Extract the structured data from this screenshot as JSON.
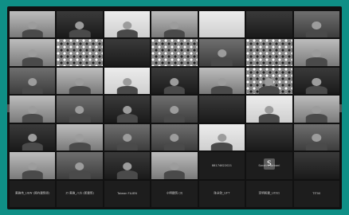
{
  "meeting": {
    "tiles": [
      {
        "label": "",
        "style": "bright",
        "person": true
      },
      {
        "label": "",
        "style": "dark",
        "person": true
      },
      {
        "label": "",
        "style": "light",
        "person": true
      },
      {
        "label": "",
        "style": "bright",
        "person": true
      },
      {
        "label": "",
        "style": "light",
        "person": false
      },
      {
        "label": "",
        "style": "dark",
        "person": false
      },
      {
        "label": "",
        "style": "mid",
        "person": true
      },
      {
        "label": "",
        "style": "bright",
        "person": true
      },
      {
        "label": "",
        "style": "patterned",
        "person": false
      },
      {
        "label": "",
        "style": "dark",
        "person": false
      },
      {
        "label": "",
        "style": "patterned",
        "person": false
      },
      {
        "label": "",
        "style": "mid",
        "person": true
      },
      {
        "label": "",
        "style": "patterned",
        "person": false
      },
      {
        "label": "",
        "style": "bright",
        "person": true
      },
      {
        "label": "",
        "style": "mid",
        "person": true
      },
      {
        "label": "",
        "style": "bright",
        "person": true
      },
      {
        "label": "",
        "style": "light",
        "person": true
      },
      {
        "label": "",
        "style": "dark",
        "person": true
      },
      {
        "label": "",
        "style": "bright",
        "person": true
      },
      {
        "label": "",
        "style": "patterned",
        "person": true
      },
      {
        "label": "",
        "style": "dark",
        "person": true
      },
      {
        "label": "",
        "style": "bright",
        "person": true
      },
      {
        "label": "",
        "style": "mid",
        "person": true
      },
      {
        "label": "",
        "style": "dark",
        "person": true
      },
      {
        "label": "",
        "style": "mid",
        "person": true
      },
      {
        "label": "",
        "style": "dark",
        "person": false
      },
      {
        "label": "",
        "style": "light",
        "person": true
      },
      {
        "label": "",
        "style": "bright",
        "person": true
      },
      {
        "label": "",
        "style": "dark",
        "person": true
      },
      {
        "label": "",
        "style": "bright",
        "person": true
      },
      {
        "label": "",
        "style": "mid",
        "person": true
      },
      {
        "label": "",
        "style": "mid",
        "person": true
      },
      {
        "label": "",
        "style": "light",
        "person": true
      },
      {
        "label": "",
        "style": "dark",
        "person": false
      },
      {
        "label": "",
        "style": "mid",
        "person": true
      },
      {
        "label": "",
        "style": "bright",
        "person": true
      },
      {
        "label": "",
        "style": "mid",
        "person": true
      },
      {
        "label": "",
        "style": "dark",
        "person": true
      },
      {
        "label": "",
        "style": "bright",
        "person": true
      },
      {
        "label": "",
        "style": "light",
        "person": false
      },
      {
        "label": "",
        "style": "namecard",
        "person": false,
        "initial": "S",
        "sublabel": "Sarah / Torbani"
      },
      {
        "label": "",
        "style": "dark",
        "person": false
      },
      {
        "label": "黄雅伟_LIEW (简约建筑师)",
        "style": "namecard",
        "person": false
      },
      {
        "label": "Zi 黄雅_八方 (新建筑)",
        "style": "namecard",
        "person": false
      },
      {
        "label": "Taiwan FLUEN",
        "style": "namecard",
        "person": false
      },
      {
        "label": "小明建筑 (3)",
        "style": "namecard",
        "person": false
      },
      {
        "label": "陈永钦_LIFT",
        "style": "namecard",
        "person": false
      },
      {
        "label": "李明和建_LIOS1",
        "style": "namecard",
        "person": false
      },
      {
        "label": "TITIVI",
        "style": "namecard",
        "person": false
      }
    ],
    "center_label": "88174622021"
  }
}
